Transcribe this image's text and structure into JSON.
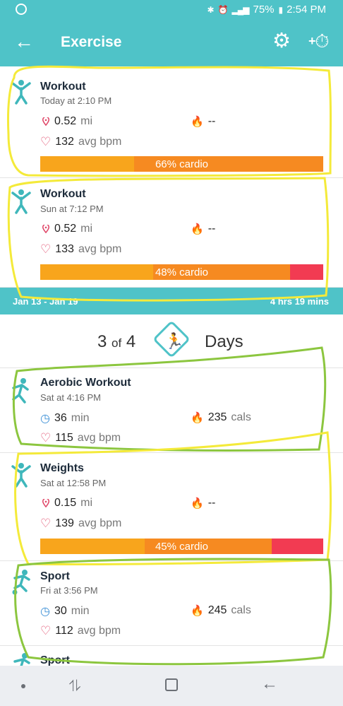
{
  "status_bar": {
    "battery": "75%",
    "time": "2:54 PM"
  },
  "app_bar": {
    "title": "Exercise"
  },
  "cards_top": [
    {
      "name": "Workout",
      "when": "Today at 2:10 PM",
      "stat1_value": "0.52",
      "stat1_unit": "mi",
      "stat2_value": "--",
      "bpm_value": "132",
      "bpm_unit": "avg bpm",
      "cardio_label": "66% cardio",
      "cardio_fraction": 0.66
    },
    {
      "name": "Workout",
      "when": "Sun at 7:12 PM",
      "stat1_value": "0.52",
      "stat1_unit": "mi",
      "stat2_value": "--",
      "bpm_value": "133",
      "bpm_unit": "avg bpm",
      "cardio_label": "48% cardio",
      "cardio_fraction": 0.48
    }
  ],
  "week": {
    "range": "Jan 13 - Jan 19",
    "total": "4 hrs 19 mins"
  },
  "days": {
    "count": "3",
    "of_text": "of",
    "goal": "4",
    "label": "Days"
  },
  "cards_week": [
    {
      "name": "Aerobic Workout",
      "when": "Sat at 4:16 PM",
      "stat1_value": "36",
      "stat1_unit": "min",
      "stat2_value": "235",
      "stat2_unit": "cals",
      "bpm_value": "115",
      "bpm_unit": "avg bpm"
    },
    {
      "name": "Weights",
      "when": "Sat at 12:58 PM",
      "stat1_value": "0.15",
      "stat1_unit": "mi",
      "stat2_value": "--",
      "bpm_value": "139",
      "bpm_unit": "avg bpm",
      "cardio_label": "45% cardio",
      "cardio_fraction": 0.45
    },
    {
      "name": "Sport",
      "when": "Fri at 3:56 PM",
      "stat1_value": "30",
      "stat1_unit": "min",
      "stat2_value": "245",
      "stat2_unit": "cals",
      "bpm_value": "112",
      "bpm_unit": "avg bpm"
    },
    {
      "name": "Sport"
    }
  ],
  "colors": {
    "accent": "#4fc3c8",
    "highlight_yellow": "#f4ea3a",
    "highlight_green": "#8cc63f",
    "cardio_orange": "#f68a21",
    "fat_burn_yellow": "#f8a51c",
    "peak_red": "#f23b52"
  },
  "icons": [
    "back-arrow-icon",
    "gear-icon",
    "add-stopwatch-icon",
    "workout-person-icon",
    "location-pin-icon",
    "flame-icon",
    "heart-icon",
    "clock-icon",
    "running-icon",
    "sport-icon"
  ]
}
